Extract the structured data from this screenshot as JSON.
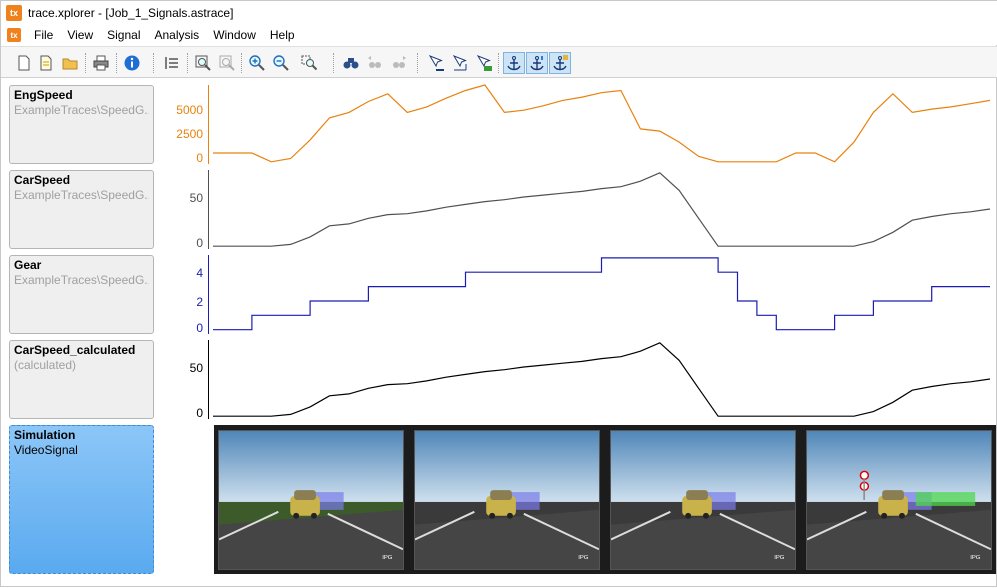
{
  "window": {
    "title": "trace.xplorer - [Job_1_Signals.astrace]",
    "logo_text": "tx"
  },
  "menu": [
    "File",
    "View",
    "Signal",
    "Analysis",
    "Window",
    "Help"
  ],
  "toolbar": {
    "buttons": [
      "new-icon",
      "new-note-icon",
      "open-folder-icon",
      "print-icon",
      "info-icon",
      "layout-icon",
      "zoom-fit-icon",
      "zoom-fit-disabled-icon",
      "zoom-in-icon",
      "zoom-out-icon",
      "zoom-select-icon",
      "find-icon",
      "find-prev-icon",
      "find-next-icon",
      "cursor-icon",
      "cursor-range-icon",
      "cursor-data-icon",
      "anchor-icon",
      "anchor-left-icon",
      "anchor-lock-icon"
    ]
  },
  "signals": [
    {
      "name": "EngSpeed",
      "source": "ExampleTraces\\SpeedG...",
      "color": "#e8820e",
      "ticks": [
        "5000",
        "2500",
        "0"
      ]
    },
    {
      "name": "CarSpeed",
      "source": "ExampleTraces\\SpeedG...",
      "color": "#505050",
      "ticks": [
        "50",
        "0"
      ]
    },
    {
      "name": "Gear",
      "source": "ExampleTraces\\SpeedG...",
      "color": "#1c1cb4",
      "ticks": [
        "4",
        "2",
        "0"
      ]
    },
    {
      "name": "CarSpeed_calculated",
      "source": "(calculated)",
      "color": "#000000",
      "ticks": [
        "50",
        "0"
      ]
    },
    {
      "name": "Simulation",
      "source": "VideoSignal",
      "color": "#000000",
      "ticks": []
    }
  ],
  "video": {
    "watermark": "IPG",
    "frames": 4
  },
  "chart_data": [
    {
      "type": "line",
      "title": "EngSpeed",
      "ylim": [
        -200,
        7000
      ],
      "x": [
        0,
        1,
        2,
        3,
        4,
        5,
        6,
        7,
        8,
        9,
        10,
        11,
        12,
        13,
        14,
        15,
        16,
        17,
        18,
        19,
        20,
        21,
        22,
        23,
        24,
        25,
        26,
        27,
        28,
        29,
        30,
        31,
        32,
        33,
        34,
        35,
        36,
        37,
        38,
        39,
        40
      ],
      "values": [
        800,
        800,
        800,
        0,
        300,
        2000,
        4000,
        4500,
        5500,
        6200,
        4500,
        5000,
        5800,
        6500,
        7000,
        4500,
        4700,
        5100,
        5600,
        5900,
        6300,
        6500,
        3000,
        2800,
        1800,
        500,
        0,
        0,
        0,
        0,
        800,
        800,
        0,
        1800,
        4500,
        6200,
        4500,
        4800,
        5000,
        5300,
        5600
      ]
    },
    {
      "type": "line",
      "title": "CarSpeed",
      "ylim": [
        -3,
        82
      ],
      "x": [
        0,
        1,
        2,
        3,
        4,
        5,
        6,
        7,
        8,
        9,
        10,
        11,
        12,
        13,
        14,
        15,
        16,
        17,
        18,
        19,
        20,
        21,
        22,
        23,
        24,
        25,
        26,
        27,
        28,
        29,
        30,
        31,
        32,
        33,
        34,
        35,
        36,
        37,
        38,
        39,
        40
      ],
      "values": [
        0,
        0,
        0,
        0,
        2,
        10,
        22,
        24,
        30,
        34,
        35,
        38,
        42,
        45,
        48,
        50,
        53,
        55,
        57,
        59,
        62,
        64,
        70,
        79,
        60,
        30,
        0,
        0,
        0,
        0,
        0,
        0,
        0,
        0,
        5,
        15,
        28,
        32,
        35,
        37,
        40
      ]
    },
    {
      "type": "line",
      "title": "Gear",
      "ylim": [
        -0.3,
        5.2
      ],
      "x": [
        0,
        1,
        2,
        3,
        4,
        5,
        6,
        7,
        8,
        9,
        10,
        11,
        12,
        13,
        14,
        15,
        16,
        17,
        18,
        19,
        20,
        21,
        22,
        23,
        24,
        25,
        26,
        27,
        28,
        29,
        30,
        31,
        32,
        33,
        34,
        35,
        36,
        37,
        38,
        39,
        40
      ],
      "values": [
        0,
        0,
        1,
        1,
        1,
        2,
        2,
        2,
        3,
        3,
        3,
        3,
        3,
        4,
        4,
        4,
        4,
        4,
        4,
        4,
        5,
        5,
        5,
        5,
        5,
        5,
        4,
        2,
        1,
        0,
        0,
        0,
        1,
        1,
        2,
        2,
        2,
        3,
        3,
        3,
        3
      ]
    },
    {
      "type": "line",
      "title": "CarSpeed_calculated",
      "ylim": [
        -3,
        82
      ],
      "x": [
        0,
        1,
        2,
        3,
        4,
        5,
        6,
        7,
        8,
        9,
        10,
        11,
        12,
        13,
        14,
        15,
        16,
        17,
        18,
        19,
        20,
        21,
        22,
        23,
        24,
        25,
        26,
        27,
        28,
        29,
        30,
        31,
        32,
        33,
        34,
        35,
        36,
        37,
        38,
        39,
        40
      ],
      "values": [
        0,
        0,
        0,
        0,
        2,
        10,
        22,
        24,
        30,
        34,
        35,
        38,
        42,
        45,
        48,
        50,
        53,
        55,
        57,
        59,
        62,
        64,
        70,
        79,
        60,
        30,
        0,
        0,
        0,
        0,
        0,
        0,
        0,
        0,
        5,
        15,
        28,
        32,
        35,
        37,
        40
      ]
    }
  ]
}
